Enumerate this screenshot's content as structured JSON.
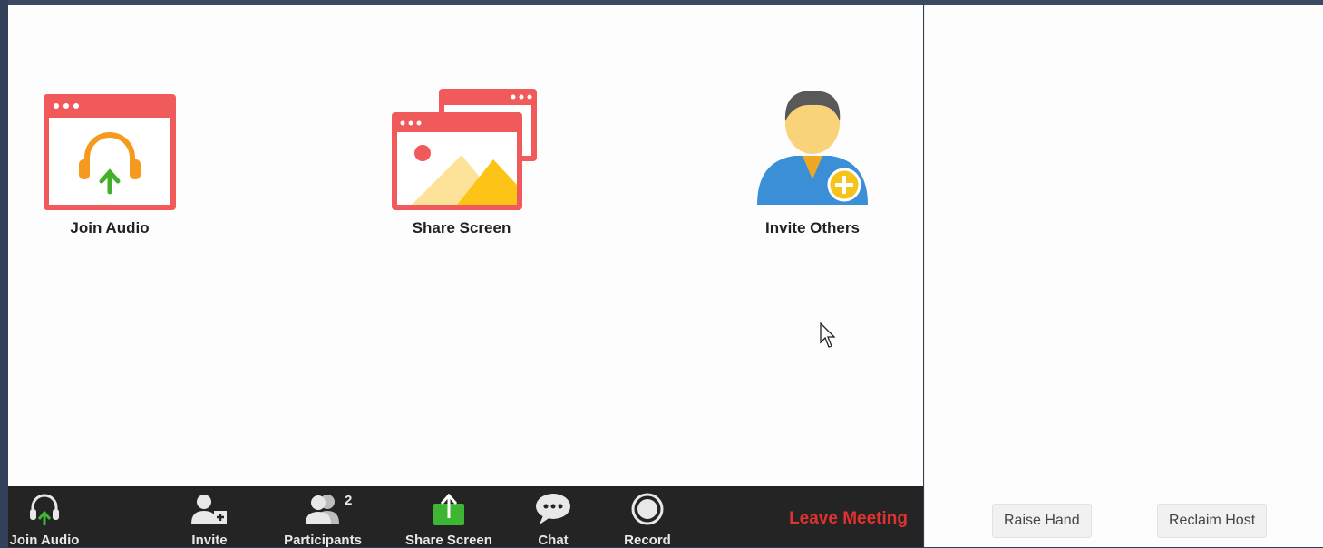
{
  "main": {
    "tiles": [
      {
        "label": "Join Audio"
      },
      {
        "label": "Share Screen"
      },
      {
        "label": "Invite Others"
      }
    ]
  },
  "toolbar": {
    "items": [
      {
        "label": "Join Audio",
        "icon": "headphones-icon"
      },
      {
        "label": "Invite",
        "icon": "add-user-icon"
      },
      {
        "label": "Participants",
        "icon": "participants-icon",
        "badge": "2"
      },
      {
        "label": "Share Screen",
        "icon": "share-screen-icon"
      },
      {
        "label": "Chat",
        "icon": "chat-icon"
      },
      {
        "label": "Record",
        "icon": "record-icon"
      }
    ],
    "leave_label": "Leave Meeting"
  },
  "side": {
    "raise_hand_label": "Raise Hand",
    "reclaim_host_label": "Reclaim Host"
  },
  "colors": {
    "accent_red": "#f05a5b",
    "leave_red": "#e0322e",
    "share_green": "#3fb534",
    "toolbar_bg": "#242424"
  }
}
